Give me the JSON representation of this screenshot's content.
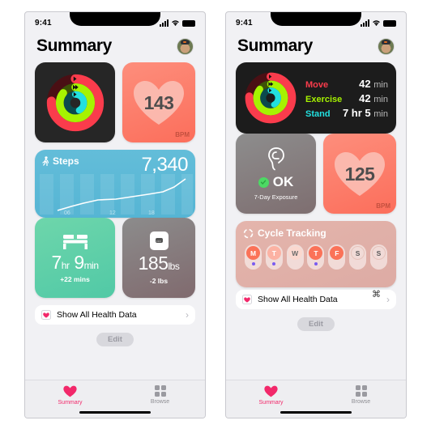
{
  "meta": {
    "accent_pink": "#f2286a",
    "move_color": "#fa3c4c",
    "exercise_color": "#a6f301",
    "stand_color": "#22e0e0"
  },
  "status_bar": {
    "time": "9:41",
    "signal_icon": "cellular-signal-icon",
    "wifi_icon": "wifi-icon",
    "battery_icon": "battery-icon"
  },
  "header": {
    "title": "Summary",
    "avatar_name": "profile-avatar"
  },
  "phone_left": {
    "rings_card": {
      "name": "activity-rings-card",
      "move_pct": 76,
      "exercise_pct": 86,
      "stand_pct": 42
    },
    "heart_card": {
      "value": "143",
      "unit": "BPM"
    },
    "steps_card": {
      "label": "Steps",
      "value": "7,340",
      "icon": "walking-figure-icon",
      "axis_ticks": [
        "06",
        "12",
        "18"
      ]
    },
    "sleep_card": {
      "icon": "bed-icon",
      "hours": "7",
      "hours_unit": "hr",
      "minutes": "9",
      "minutes_unit": "min",
      "delta": "+22 mins"
    },
    "weight_card": {
      "icon": "scale-icon",
      "value": "185",
      "unit": "lbs",
      "delta": "-2 lbs"
    }
  },
  "phone_right": {
    "activity_card": {
      "rows": [
        {
          "name": "Move",
          "value": "42",
          "unit": "min",
          "color": "#fa3c4c"
        },
        {
          "name": "Exercise",
          "value": "42",
          "unit": "min",
          "color": "#a6f301"
        },
        {
          "name": "Stand",
          "value": "7 hr 5",
          "unit": "min",
          "color": "#22e0e0"
        }
      ],
      "move_pct": 76,
      "exercise_pct": 86,
      "stand_pct": 42
    },
    "hearing_card": {
      "icon": "ear-icon",
      "status": "OK",
      "check_icon": "check-circle-icon",
      "subtitle": "7-Day Exposure"
    },
    "heart_card": {
      "value": "125",
      "unit": "BPM"
    },
    "cycle_card": {
      "title": "Cycle Tracking",
      "icon": "cycle-icon",
      "days": [
        {
          "label": "M",
          "style": "solid",
          "dot": true
        },
        {
          "label": "T",
          "style": "medium",
          "dot": true
        },
        {
          "label": "W",
          "style": "light",
          "dot": false
        },
        {
          "label": "T",
          "style": "solid",
          "dot": true
        },
        {
          "label": "F",
          "style": "solid",
          "dot": false
        },
        {
          "label": "S",
          "style": "outline",
          "dot": false
        },
        {
          "label": "S",
          "style": "outline",
          "dot": false
        }
      ]
    },
    "cursor_glyph": "⌘"
  },
  "show_all": {
    "label": "Show All Health Data",
    "icon": "heart-icon",
    "chevron": "›"
  },
  "edit_button": {
    "label": "Edit"
  },
  "tabbar": {
    "tabs": [
      {
        "label": "Summary",
        "icon": "heart-icon",
        "active": true
      },
      {
        "label": "Browse",
        "icon": "grid-icon",
        "active": false
      }
    ]
  }
}
